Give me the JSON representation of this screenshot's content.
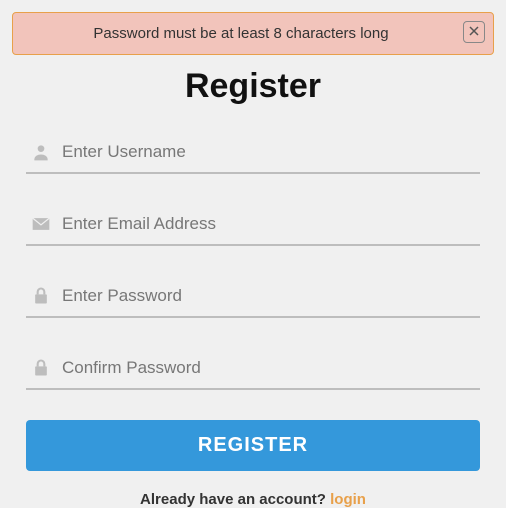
{
  "alert": {
    "message": "Password must be at least 8 characters long"
  },
  "title": "Register",
  "fields": {
    "username": {
      "placeholder": "Enter Username",
      "value": ""
    },
    "email": {
      "placeholder": "Enter Email Address",
      "value": ""
    },
    "password": {
      "placeholder": "Enter Password",
      "value": ""
    },
    "confirm": {
      "placeholder": "Confirm Password",
      "value": ""
    }
  },
  "submit_label": "REGISTER",
  "login_prompt": "Already have an account? ",
  "login_link_label": "login"
}
